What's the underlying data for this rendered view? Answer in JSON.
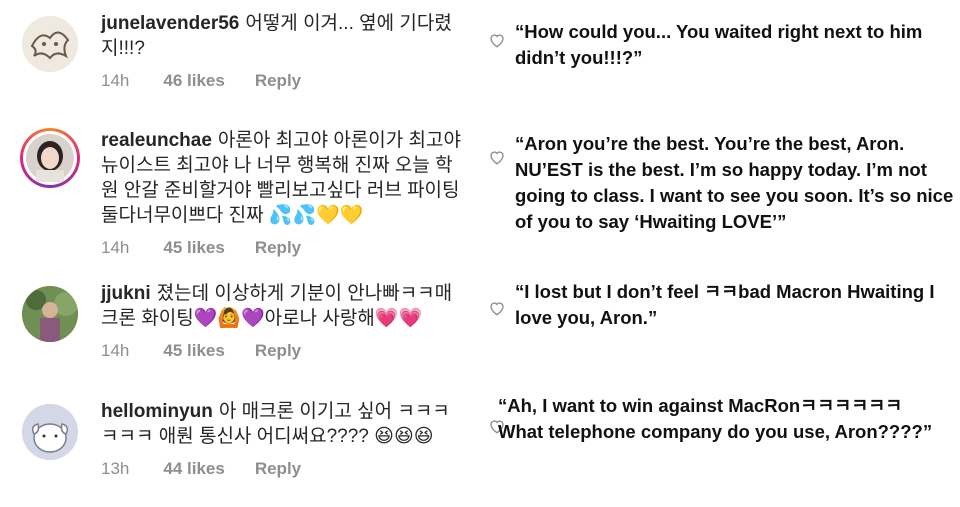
{
  "comments": [
    {
      "username": "junelavender56",
      "text": "어떻게 이겨... 옆에 기다렸지!!!?",
      "time": "14h",
      "likes": "46 likes",
      "reply": "Reply",
      "avatar": "sketch-avatar",
      "translation": "“How could you... You waited right next to him didn’t you!!!?”"
    },
    {
      "username": "realeunchae",
      "text": "아론아 최고야 아론이가 최고야 뉴이스트 최고야 나 너무 행복해 진짜 오늘 학원 안갈 준비할거야 빨리보고싶다 러브 파이팅 둘다너무이쁘다 진짜 💦💦💛💛",
      "time": "14h",
      "likes": "45 likes",
      "reply": "Reply",
      "avatar": "girl-photo-avatar",
      "translation": "“Aron you’re the best. You’re the best, Aron. NU’EST is the best. I’m so happy today. I’m not going to class. I want to see you soon. It’s so nice of you to say ‘Hwaiting LOVE’”"
    },
    {
      "username": "jjukni",
      "text": "졌는데 이상하게 기분이 안나빠ㅋㅋ매크론 화이팅💜🙆💜아로나 사랑해💗💗",
      "time": "14h",
      "likes": "45 likes",
      "reply": "Reply",
      "avatar": "outdoor-photo-avatar",
      "translation": "“I lost but I don’t feel ㅋㅋbad Macron Hwaiting I love you, Aron.”"
    },
    {
      "username": "hellominyun",
      "text": "아 매크론 이기고 싶어 ㅋㅋㅋㅋㅋㅋ 애뤈 통신사 어디써요???? 😆😆😆",
      "time": "13h",
      "likes": "44 likes",
      "reply": "Reply",
      "avatar": "cartoon-avatar",
      "translation": "“Ah, I want to win against MacRonㅋㅋㅋㅋㅋㅋ What telephone company do you use, Aron????”"
    }
  ]
}
